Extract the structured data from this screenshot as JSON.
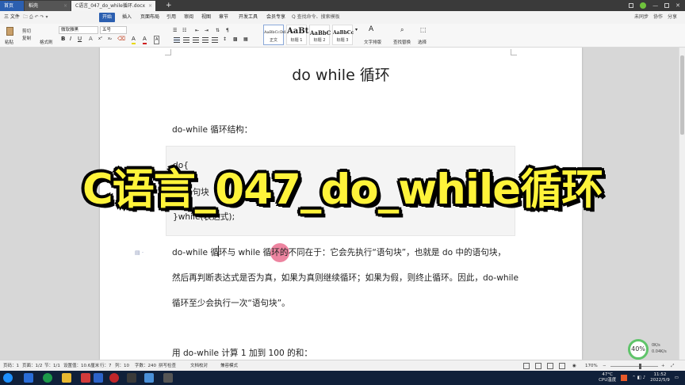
{
  "tabs": {
    "home": "首页",
    "video": "稻壳",
    "document": "C语言_047_do_while循环.docx",
    "new_tab": "+"
  },
  "menubar": {
    "file": "三 文件",
    "active": "开始",
    "items": [
      "插入",
      "页面布局",
      "引用",
      "审阅",
      "视图",
      "章节",
      "开发工具",
      "会员专享"
    ],
    "search": "Q 查找命令、搜索模板",
    "right": [
      "未同步",
      "协作",
      "分享"
    ]
  },
  "ribbon": {
    "paste": "粘贴",
    "cut": "剪切",
    "copy": "复制",
    "format_painter": "格式刷",
    "font_name": "微软雅黑",
    "font_size": "五号",
    "styles": [
      {
        "sample": "AaBbCcDd",
        "name": "正文"
      },
      {
        "sample": "AaBt",
        "name": "标题 1"
      },
      {
        "sample": "AaBbC",
        "name": "标题 2"
      },
      {
        "sample": "AaBbCc",
        "name": "标题 3"
      }
    ],
    "text_layout": "文字排版",
    "find_replace": "查找替换",
    "select": "选择"
  },
  "document": {
    "title": "do while 循环",
    "subheading": "do-while 循环结构：",
    "code": [
      "do{",
      "语句块",
      "}while(表达式);"
    ],
    "paragraph_lines": [
      "do-while 循环与 while 循环的不同在于：它会先执行“语句块”，也就是 do 中的语句块，",
      "然后再判断表达式是否为真，如果为真则继续循环；如果为假，则终止循环。因此，do-while",
      "循环至少会执行一次“语句块”。"
    ],
    "next_heading": "用 do-while 计算 1 加到 100 的和："
  },
  "overlay": {
    "title": "C语言_047_do_while循环"
  },
  "perf": {
    "value": "40%",
    "up": "0K/s",
    "down": "0.04K/s"
  },
  "statusbar": {
    "page": "页码：1",
    "pages": "页面：1/2",
    "section": "节：1/1",
    "position": "设置值：10.6厘米",
    "row": "行：7",
    "col": "列：10",
    "words": "字数：240",
    "spell": "拼写检查",
    "doc_check": "文档校对",
    "compat": "兼容模式",
    "zoom": "170%"
  },
  "taskbar": {
    "weather": "47°C",
    "weather_label": "CPU温度",
    "time": "11:52",
    "date": "2022/5/9"
  }
}
